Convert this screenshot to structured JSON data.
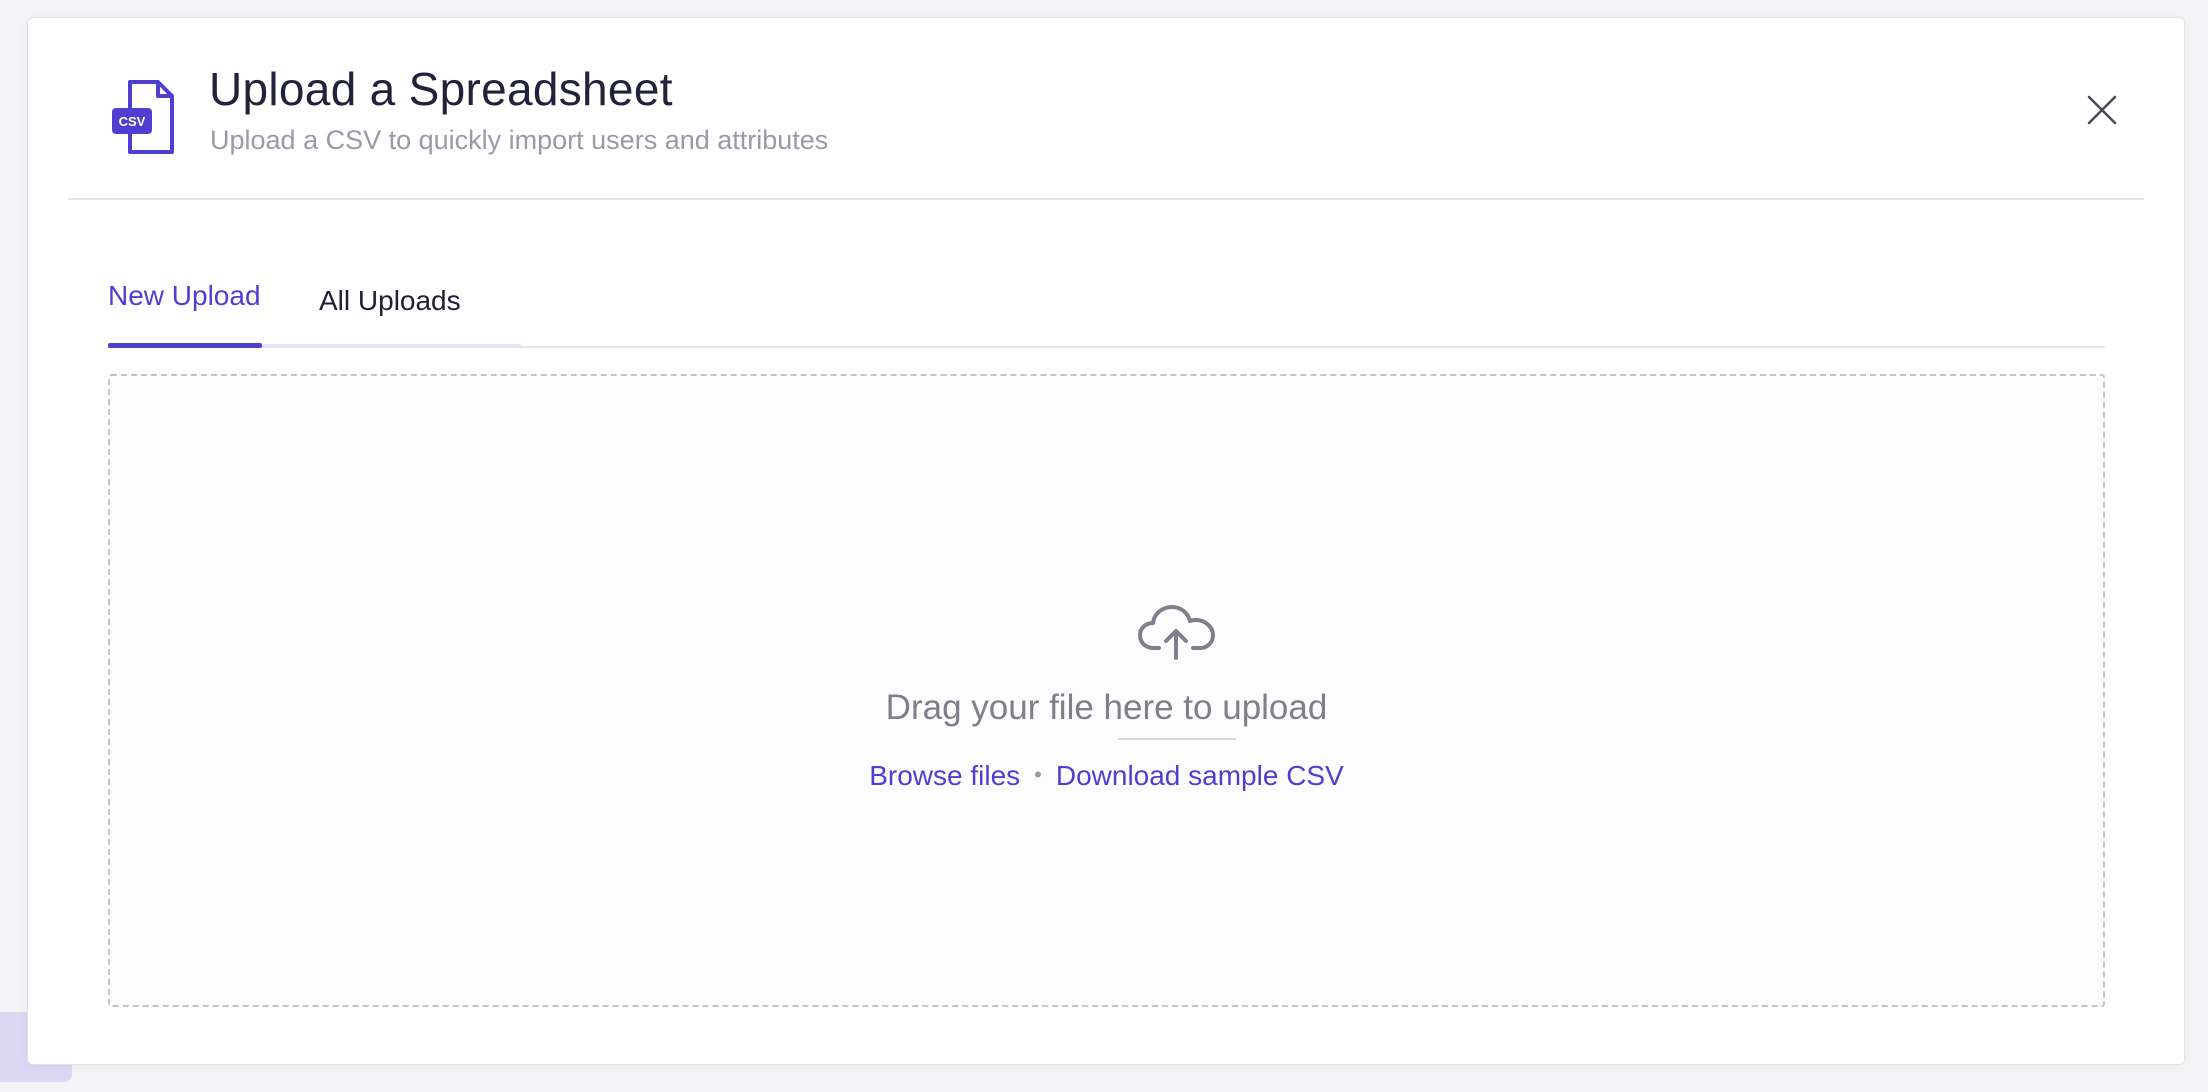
{
  "modal": {
    "title": "Upload a Spreadsheet",
    "subtitle": "Upload a CSV to quickly import users and attributes",
    "icon_badge": "CSV",
    "close_icon": "close-icon"
  },
  "tabs": [
    {
      "label": "New Upload",
      "active": true
    },
    {
      "label": "All Uploads",
      "active": false
    }
  ],
  "dropzone": {
    "icon": "cloud-upload-icon",
    "drag_text": "Drag your file here to upload",
    "browse_label": "Browse files",
    "separator": "•",
    "sample_label": "Download sample CSV"
  },
  "colors": {
    "accent": "#4f3fd1",
    "title": "#22223a",
    "muted": "#9a9aa6"
  }
}
